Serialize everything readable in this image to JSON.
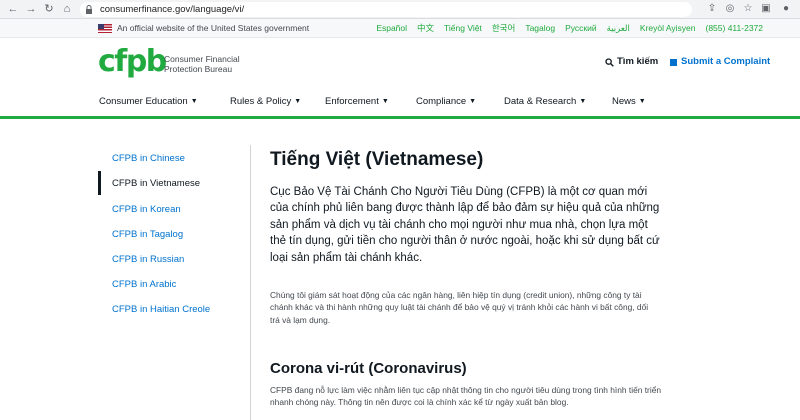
{
  "browser": {
    "url": "consumerfinance.gov/language/vi/"
  },
  "gov_banner": {
    "text": "An official website of the United States government",
    "languages": [
      "Español",
      "中文",
      "Tiếng Việt",
      "한국어",
      "Tagalog",
      "Русский",
      "العربية",
      "Kreyòl Ayisyen"
    ],
    "phone": "(855) 411-2372"
  },
  "header": {
    "logo_text": "cfpb",
    "bureau_line1": "Consumer Financial",
    "bureau_line2": "Protection Bureau",
    "search_label": "Tìm kiếm",
    "complaint_label": "Submit a Complaint"
  },
  "main_nav": {
    "items": [
      "Consumer Education",
      "Rules & Policy",
      "Enforcement",
      "Compliance",
      "Data & Research",
      "News"
    ]
  },
  "side_nav": {
    "items": [
      {
        "label": "CFPB in Chinese",
        "active": false
      },
      {
        "label": "CFPB in Vietnamese",
        "active": true
      },
      {
        "label": "CFPB in Korean",
        "active": false
      },
      {
        "label": "CFPB in Tagalog",
        "active": false
      },
      {
        "label": "CFPB in Russian",
        "active": false
      },
      {
        "label": "CFPB in Arabic",
        "active": false
      },
      {
        "label": "CFPB in Haitian Creole",
        "active": false
      }
    ]
  },
  "content": {
    "title": "Tiếng Việt (Vietnamese)",
    "lead": "Cục Bảo Vệ Tài Chánh Cho Người Tiêu Dùng (CFPB) là một cơ quan mới của chính phủ liên bang được thành lập để bảo đảm sự hiệu quả của những sản phẩm và dịch vụ tài chánh cho mọi người như mua nhà, chọn lựa một thẻ tín dụng, gửi tiền cho người thân ở nước ngoài, hoặc khi sử dụng bất cứ loại sản phẩm tài chánh khác.",
    "paragraph": "Chúng tôi giám sát hoạt động của các ngân hàng, liên hiệp tín dụng (credit union), những công ty tài chánh khác và thi hành những quy luật tài chánh để bảo vệ quý vị tránh khỏi các hành vi bất công, dối trá và lạm dụng.",
    "section_title": "Corona vi-rút (Coronavirus)",
    "section_text": "CFPB đang nỗ lực làm việc nhằm liên tục cập nhật thông tin cho người tiêu dùng trong tình hình tiến triển nhanh chóng này. Thông tin nên được coi là chính xác kể từ ngày xuất bản blog."
  },
  "colors": {
    "green": "#20aa3f",
    "blue": "#0072ce",
    "text": "#101820"
  }
}
